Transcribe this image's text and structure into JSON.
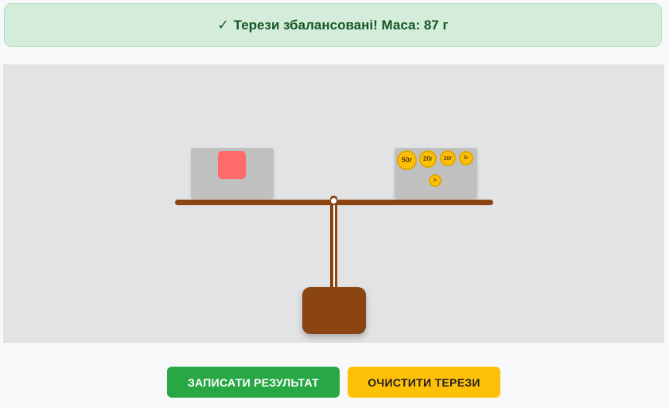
{
  "status": {
    "check": "✓",
    "message": "Терези збалансовані! Маса: 87 г"
  },
  "scale": {
    "left_pan": {
      "object_color": "#ff6b6b"
    },
    "right_pan": {
      "weights": [
        {
          "label": "50г",
          "grams": 50
        },
        {
          "label": "20г",
          "grams": 20
        },
        {
          "label": "10г",
          "grams": 10
        },
        {
          "label": "5г",
          "grams": 5
        },
        {
          "label": "2г",
          "grams": 2
        }
      ]
    },
    "balanced": true
  },
  "buttons": {
    "record_label": "ЗАПИСАТИ РЕЗУЛЬТАТ",
    "clear_label": "ОЧИСТИТИ ТЕРЕЗИ"
  },
  "colors": {
    "success_bg": "#d4edda",
    "success_text": "#155724",
    "beam": "#8b4513",
    "pan": "#c0c0c0",
    "weight": "#ffc107",
    "record_button": "#28a745",
    "clear_button": "#ffc107"
  }
}
